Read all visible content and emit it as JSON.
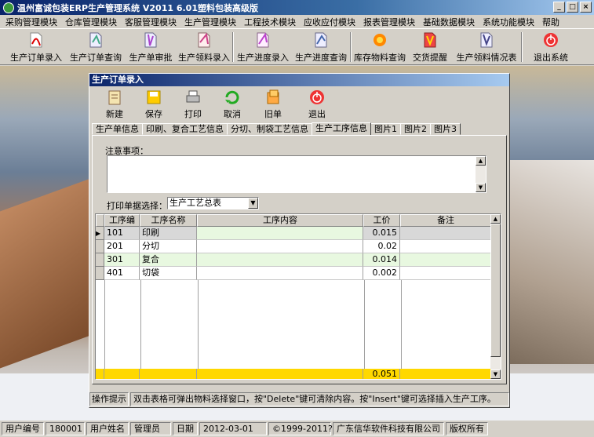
{
  "window": {
    "title": "温州富诚包装ERP生产管理系统  V2011  6.01塑料包装高级版",
    "buttons": [
      "_",
      "□",
      "×"
    ]
  },
  "menu": [
    "采购管理模块",
    "仓库管理模块",
    "客服管理模块",
    "生产管理模块",
    "工程技术模块",
    "应收应付模块",
    "报表管理模块",
    "基础数据模块",
    "系统功能模块",
    "帮助"
  ],
  "toolbar": [
    {
      "label": "生产订单录入",
      "icon": "pdf-document-icon"
    },
    {
      "label": "生产订单查询",
      "icon": "document-search-icon"
    },
    {
      "label": "生产单审批",
      "icon": "approve-document-icon"
    },
    {
      "label": "生产领料录入",
      "icon": "material-pickup-icon"
    },
    {
      "label": "生产进度录入",
      "icon": "progress-entry-icon"
    },
    {
      "label": "生产进度查询",
      "icon": "progress-query-icon"
    },
    {
      "label": "库存物料查询",
      "icon": "inventory-icon"
    },
    {
      "label": "交货提醒",
      "icon": "delivery-reminder-icon"
    },
    {
      "label": "生产领料情况表",
      "icon": "material-report-icon"
    },
    {
      "label": "退出系统",
      "icon": "exit-icon"
    }
  ],
  "child": {
    "title": "生产订单录入",
    "buttons": [
      {
        "label": "新建",
        "icon": "new-document-icon"
      },
      {
        "label": "保存",
        "icon": "save-icon"
      },
      {
        "label": "打印",
        "icon": "printer-icon"
      },
      {
        "label": "取消",
        "icon": "cancel-icon"
      },
      {
        "label": "旧单",
        "icon": "old-orders-icon"
      },
      {
        "label": "退出",
        "icon": "exit-icon"
      }
    ],
    "tabs": [
      "生产单信息",
      "印刷、复合工艺信息",
      "分切、制袋工艺信息",
      "生产工序信息",
      "图片1",
      "图片2",
      "图片3"
    ],
    "active_tab": "生产工序信息",
    "notes_label": "注意事项：",
    "notes_value": "",
    "print_label": "打印单据选择：",
    "print_value": "生产工艺总表",
    "columns": [
      "工序编号",
      "工序名称",
      "工序内容",
      "工价",
      "备注"
    ],
    "rows": [
      [
        "101",
        "印刷",
        "",
        "0.015",
        ""
      ],
      [
        "201",
        "分切",
        "",
        "0.02",
        ""
      ],
      [
        "301",
        "复合",
        "",
        "0.014",
        ""
      ],
      [
        "401",
        "切袋",
        "",
        "0.002",
        ""
      ]
    ],
    "total": "0.051",
    "hint_label": "操作提示",
    "hint_text": "双击表格可弹出物料选择窗口，按\"Delete\"键可清除内容。按\"Insert\"键可选择插入生产工序。"
  },
  "status": [
    "用户编号",
    "180001",
    "用户姓名",
    "管理员",
    "日期",
    "2012-03-01",
    "©1999-2011?",
    "广东信华软件科技有限公司",
    "版权所有"
  ]
}
